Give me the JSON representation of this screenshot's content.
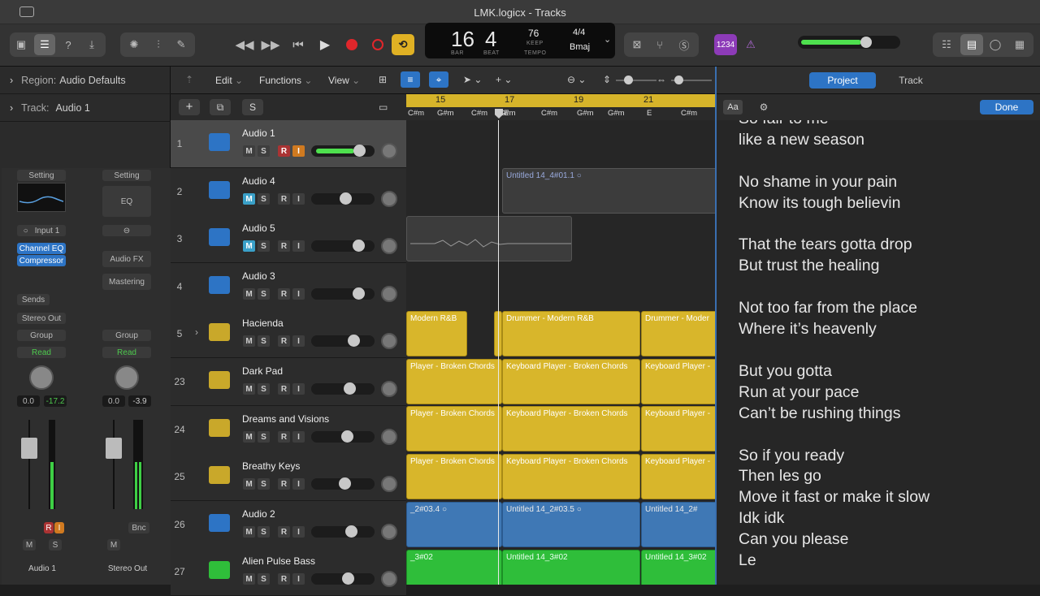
{
  "window": {
    "title": "LMK.logicx - Tracks"
  },
  "lcd": {
    "bar": "16",
    "beat": "4",
    "bar_label": "BAR",
    "beat_label": "BEAT",
    "tempo": "76",
    "tempo_keep": "KEEP",
    "tempo_label": "TEMPO",
    "signature": "4/4",
    "key": "Bmaj",
    "counter": "1234"
  },
  "inspector": {
    "region_label": "Region:",
    "region_value": "Audio Defaults",
    "track_label": "Track:",
    "track_value": "Audio 1",
    "strip1": {
      "setting": "Setting",
      "input": "Input 1",
      "plugin1": "Channel EQ",
      "plugin2": "Compressor",
      "sends": "Sends",
      "output": "Stereo Out",
      "group": "Group",
      "automation": "Read",
      "vol": "0.0",
      "peak": "-17.2",
      "mute": "M",
      "solo": "S",
      "name": "Audio 1"
    },
    "strip2": {
      "setting": "Setting",
      "eq": "EQ",
      "audiofx": "Audio FX",
      "mastering": "Mastering",
      "group": "Group",
      "automation": "Read",
      "vol": "0.0",
      "peak": "-3.9",
      "bounce": "Bnc",
      "mute": "M",
      "name": "Stereo Out"
    }
  },
  "tracks_toolbar": {
    "edit": "Edit",
    "functions": "Functions",
    "view": "View"
  },
  "tracks": [
    {
      "num": "1",
      "name": "Audio 1",
      "m": "M",
      "s": "S",
      "r": "R",
      "i": "I",
      "volume": 0.82
    },
    {
      "num": "2",
      "name": "Audio 4",
      "m": "M",
      "s": "S",
      "r": "R",
      "i": "I",
      "volume": 0.55
    },
    {
      "num": "3",
      "name": "Audio 5",
      "m": "M",
      "s": "S",
      "r": "R",
      "i": "I",
      "volume": 0.8
    },
    {
      "num": "4",
      "name": "Audio 3",
      "m": "M",
      "s": "S",
      "r": "R",
      "i": "I",
      "volume": 0.8
    },
    {
      "num": "5",
      "name": "Hacienda",
      "m": "M",
      "s": "S",
      "r": "R",
      "i": "I",
      "volume": 0.7
    },
    {
      "num": "23",
      "name": "Dark Pad",
      "m": "M",
      "s": "S",
      "r": "R",
      "i": "I",
      "volume": 0.62
    },
    {
      "num": "24",
      "name": "Dreams and Visions",
      "m": "M",
      "s": "S",
      "r": "R",
      "i": "I",
      "volume": 0.58
    },
    {
      "num": "25",
      "name": "Breathy Keys",
      "m": "M",
      "s": "S",
      "r": "R",
      "i": "I",
      "volume": 0.53
    },
    {
      "num": "26",
      "name": "Audio 2",
      "m": "M",
      "s": "S",
      "r": "R",
      "i": "I",
      "volume": 0.66
    },
    {
      "num": "27",
      "name": "Alien Pulse Bass",
      "m": "M",
      "s": "S",
      "r": "R",
      "i": "I",
      "volume": 0.6
    }
  ],
  "ruler": {
    "b15": "15",
    "b17": "17",
    "b19": "19",
    "b21": "21"
  },
  "chords": [
    "C#m",
    "G#m",
    "C#m",
    "G#m",
    "E",
    "C#m",
    "G#m",
    "G#m",
    "E",
    "C#m",
    "G#m"
  ],
  "regions": {
    "r_audio4": "Untitled 14_4#01.1",
    "r_drum1": "Modern R&B",
    "r_drum2": "Drummer - Modern R&B",
    "r_drum3": "Drummer - Moder",
    "r_kb": "Player - Broken Chords",
    "r_kb2": "Keyboard Player - Broken Chords",
    "r_kb3": "Keyboard Player -",
    "r_a2_1": "_2#03.4",
    "r_a2_2": "Untitled 14_2#03.5",
    "r_a2_3": "Untitled 14_2#",
    "r_b1": "_3#02",
    "r_b2": "Untitled 14_3#02",
    "r_b3": "Untitled 14_3#02"
  },
  "panel": {
    "tab_project": "Project",
    "tab_track": "Track",
    "font_btn": "Aa",
    "done": "Done",
    "lyrics": "So fair to me\nlike a new season\n\nNo shame in your pain\nKnow its tough believin\n\nThat the tears gotta drop\nBut trust the healing\n\nNot too far from the place\nWhere it’s heavenly\n\nBut you gotta\nRun at your pace\nCan’t be rushing things\n\nSo if you ready\nThen les go\nMove it fast or make it slow\nIdk idk\nCan you please\nLe"
  }
}
